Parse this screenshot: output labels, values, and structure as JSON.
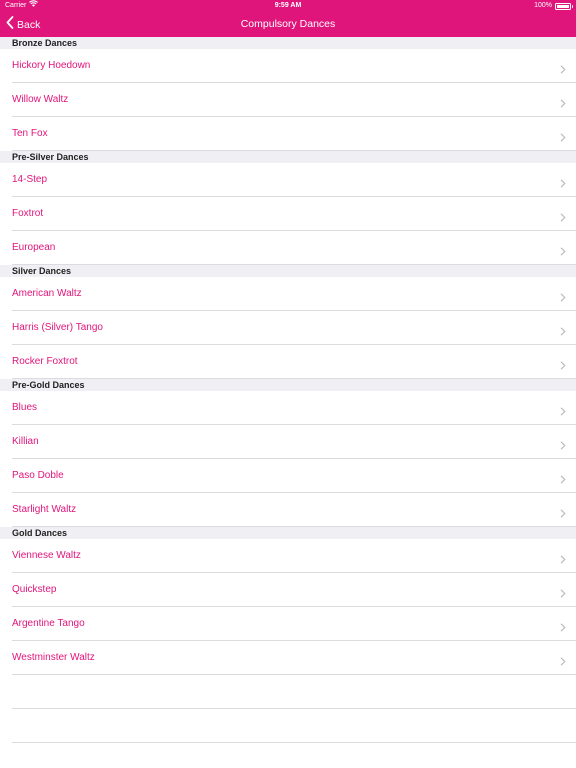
{
  "status_bar": {
    "carrier": "Carrier",
    "time": "9:59 AM",
    "battery": "100%"
  },
  "nav": {
    "back_label": "Back",
    "title": "Compulsory Dances"
  },
  "colors": {
    "accent": "#e0157b",
    "section_bg": "#efeff4"
  },
  "sections": [
    {
      "header": "Bronze Dances",
      "items": [
        "Hickory Hoedown",
        "Willow Waltz",
        "Ten Fox"
      ]
    },
    {
      "header": "Pre-Silver Dances",
      "items": [
        "14-Step",
        "Foxtrot",
        "European"
      ]
    },
    {
      "header": "Silver Dances",
      "items": [
        "American Waltz",
        "Harris (Silver) Tango",
        "Rocker Foxtrot"
      ]
    },
    {
      "header": "Pre-Gold Dances",
      "items": [
        "Blues",
        "Killian",
        "Paso Doble",
        "Starlight Waltz"
      ]
    },
    {
      "header": "Gold Dances",
      "items": [
        "Viennese Waltz",
        "Quickstep",
        "Argentine Tango",
        "Westminster Waltz"
      ]
    }
  ]
}
